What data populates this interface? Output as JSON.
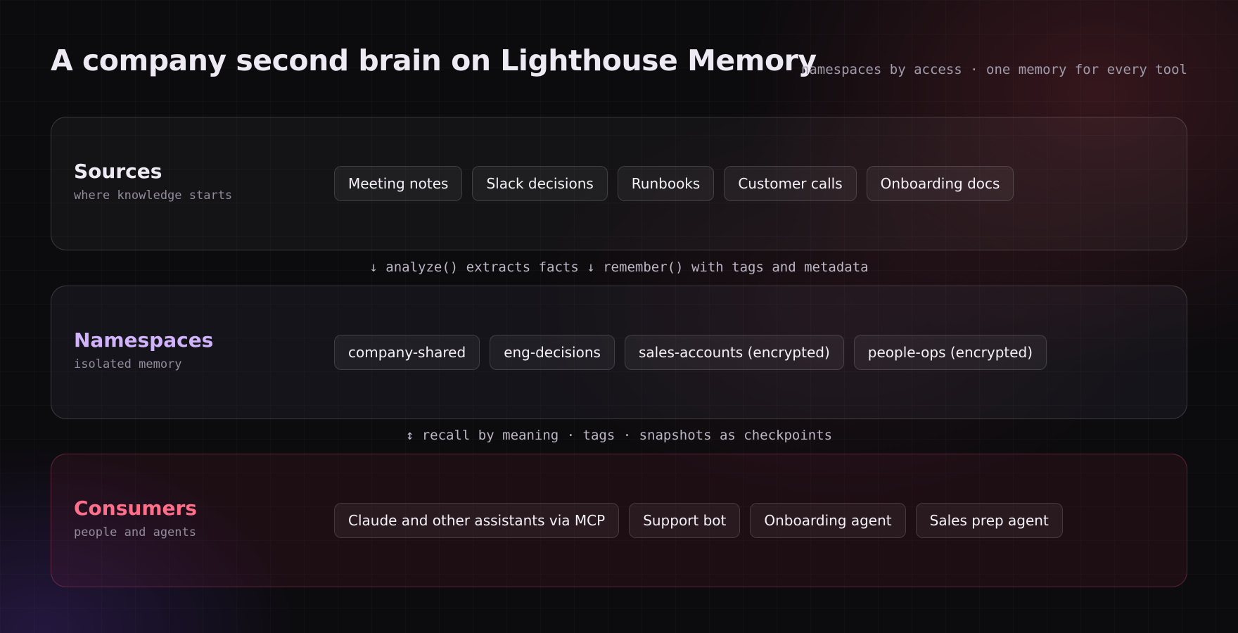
{
  "header": {
    "title": "A company second brain on Lighthouse Memory",
    "subtitle": "namespaces by access · one memory for every tool"
  },
  "panels": [
    {
      "id": "sources",
      "title": "Sources",
      "description": "where knowledge starts",
      "accent_color": "#eeeaf4",
      "items": [
        "Meeting notes",
        "Slack decisions",
        "Runbooks",
        "Customer calls",
        "Onboarding docs"
      ]
    },
    {
      "id": "namespaces",
      "title": "Namespaces",
      "description": "isolated memory",
      "accent_color": "#d1b3fb",
      "items": [
        "company-shared",
        "eng-decisions",
        "sales-accounts (encrypted)",
        "people-ops (encrypted)"
      ]
    },
    {
      "id": "consumers",
      "title": "Consumers",
      "description": "people and agents",
      "accent_color": "#ff6f8a",
      "items": [
        "Claude and other assistants via MCP",
        "Support bot",
        "Onboarding agent",
        "Sales prep agent"
      ]
    }
  ],
  "connectors": [
    "↓ analyze() extracts facts ↓ remember() with tags and metadata",
    "↕ recall by meaning · tags · snapshots as checkpoints"
  ]
}
